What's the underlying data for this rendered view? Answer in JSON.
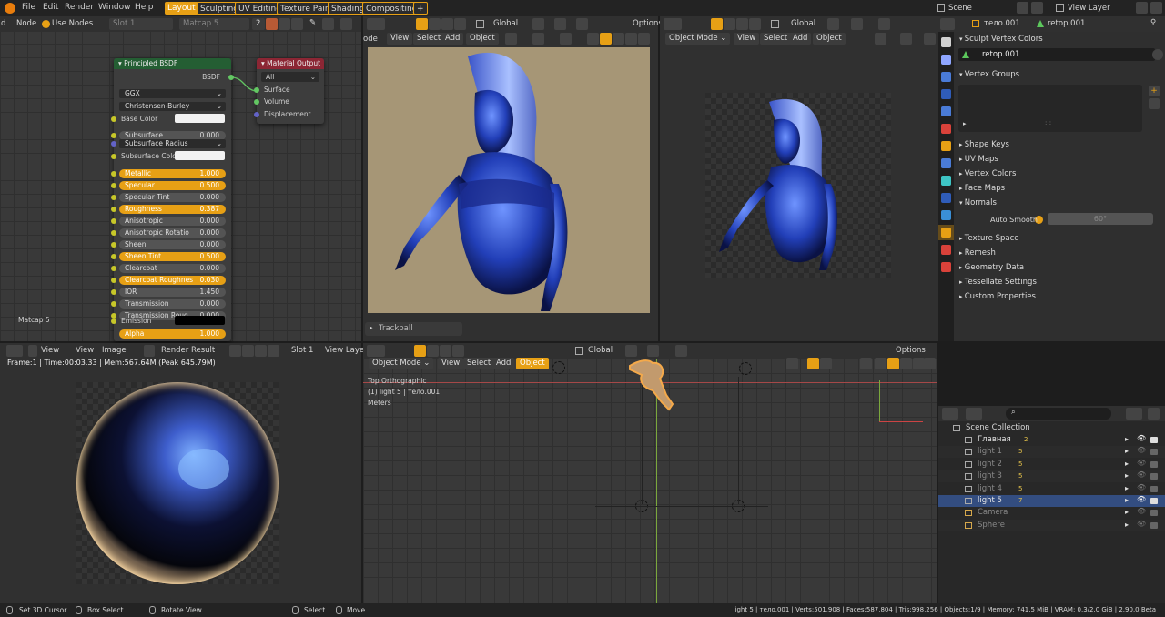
{
  "topbar": {
    "menus": [
      "File",
      "Edit",
      "Render",
      "Window",
      "Help"
    ],
    "workspaces": [
      "Layout",
      "Sculpting",
      "UV Editing",
      "Texture Paint",
      "Shading",
      "Compositing",
      "+"
    ],
    "scene": "Scene",
    "view_layer": "View Layer"
  },
  "node_editor": {
    "header": {
      "prefix": "d",
      "node": "Node",
      "use_nodes": "Use Nodes",
      "slot": "Slot 1",
      "matcap": "Matcap 5",
      "users": "2"
    },
    "footer_label": "Matcap 5",
    "bsdf": {
      "title": "Principled BSDF",
      "output": "BSDF",
      "distribution": "GGX",
      "subsurface_method": "Christensen-Burley",
      "base_color_label": "Base Color",
      "subsurface_radius": "Subsurface Radius",
      "subsurface_color_label": "Subsurface Color",
      "emission_label": "Emission",
      "fields": [
        {
          "label": "Subsurface",
          "value": "0.000",
          "hl": false
        },
        {
          "label": "Metallic",
          "value": "1.000",
          "hl": true
        },
        {
          "label": "Specular",
          "value": "0.500",
          "hl": true
        },
        {
          "label": "Specular Tint",
          "value": "0.000",
          "hl": false
        },
        {
          "label": "Roughness",
          "value": "0.387",
          "hl": true
        },
        {
          "label": "Anisotropic",
          "value": "0.000",
          "hl": false
        },
        {
          "label": "Anisotropic Rotatio",
          "value": "0.000",
          "hl": false
        },
        {
          "label": "Sheen",
          "value": "0.000",
          "hl": false
        },
        {
          "label": "Sheen Tint",
          "value": "0.500",
          "hl": true
        },
        {
          "label": "Clearcoat",
          "value": "0.000",
          "hl": false
        },
        {
          "label": "Clearcoat Roughnes",
          "value": "0.030",
          "hl": true
        },
        {
          "label": "IOR",
          "value": "1.450",
          "hl": false
        },
        {
          "label": "Transmission",
          "value": "0.000",
          "hl": false
        },
        {
          "label": "Transmission Roug",
          "value": "0.000",
          "hl": false
        }
      ],
      "alpha": {
        "label": "Alpha",
        "value": "1.000"
      }
    },
    "matout": {
      "title": "Material Output",
      "target": "All",
      "sockets": [
        "Surface",
        "Volume",
        "Displacement"
      ]
    }
  },
  "viewport_a": {
    "header": {
      "transform": "Global",
      "options": "Options",
      "mode": "ode",
      "menus": [
        "View",
        "Select",
        "Add",
        "Object"
      ]
    },
    "trackball": "Trackball"
  },
  "viewport_b": {
    "header": {
      "transform": "Global",
      "mode": "Object Mode",
      "menus": [
        "View",
        "Select",
        "Add",
        "Object"
      ]
    }
  },
  "image_editor": {
    "header": {
      "menus": [
        "View",
        "View",
        "Image"
      ],
      "render_result": "Render Result",
      "slot": "Slot 1",
      "view_layer": "View Layer"
    },
    "frame_info": "Frame:1 | Time:00:03.33 | Mem:567.64M (Peak 645.79M)"
  },
  "viewport_c": {
    "header": {
      "transform": "Global",
      "options": "Options",
      "mode": "Object Mode",
      "menus": [
        "View",
        "Select",
        "Add"
      ],
      "active_menu": "Object"
    },
    "overlay": [
      "Top Orthographic",
      "(1) light 5 | тело.001",
      "Meters"
    ]
  },
  "properties": {
    "object": "тело.001",
    "mesh": "retop.001",
    "mesh_field": "retop.001",
    "panels": [
      "Sculpt Vertex Colors",
      "Vertex Groups",
      "Shape Keys",
      "UV Maps",
      "Vertex Colors",
      "Face Maps",
      "Normals",
      "Texture Space",
      "Remesh",
      "Geometry Data",
      "Tessellate Settings",
      "Custom Properties"
    ],
    "auto_smooth_label": "Auto Smooth",
    "auto_smooth_value": "60°"
  },
  "outliner": {
    "collection": "Scene Collection",
    "items": [
      {
        "name": "Главная",
        "badge": "2"
      },
      {
        "name": "light 1",
        "badge": "5"
      },
      {
        "name": "light 2",
        "badge": "5"
      },
      {
        "name": "light 3",
        "badge": "5"
      },
      {
        "name": "light 4",
        "badge": "5"
      },
      {
        "name": "light 5",
        "badge": "7"
      },
      {
        "name": "Camera",
        "badge": ""
      },
      {
        "name": "Sphere",
        "badge": ""
      }
    ]
  },
  "statusbar": {
    "hints": [
      "Set 3D Cursor",
      "Box Select",
      "Rotate View",
      "Select",
      "Move"
    ],
    "stats": "light 5 | тело.001 | Verts:501,908 | Faces:587,804 | Tris:998,256 | Objects:1/9 | Memory: 741.5 MiB | VRAM: 0.3/2.0 GiB | 2.90.0 Beta"
  },
  "colors": {
    "accent": "#e7a015",
    "bg": "#1d1d1d",
    "header": "#303030"
  }
}
